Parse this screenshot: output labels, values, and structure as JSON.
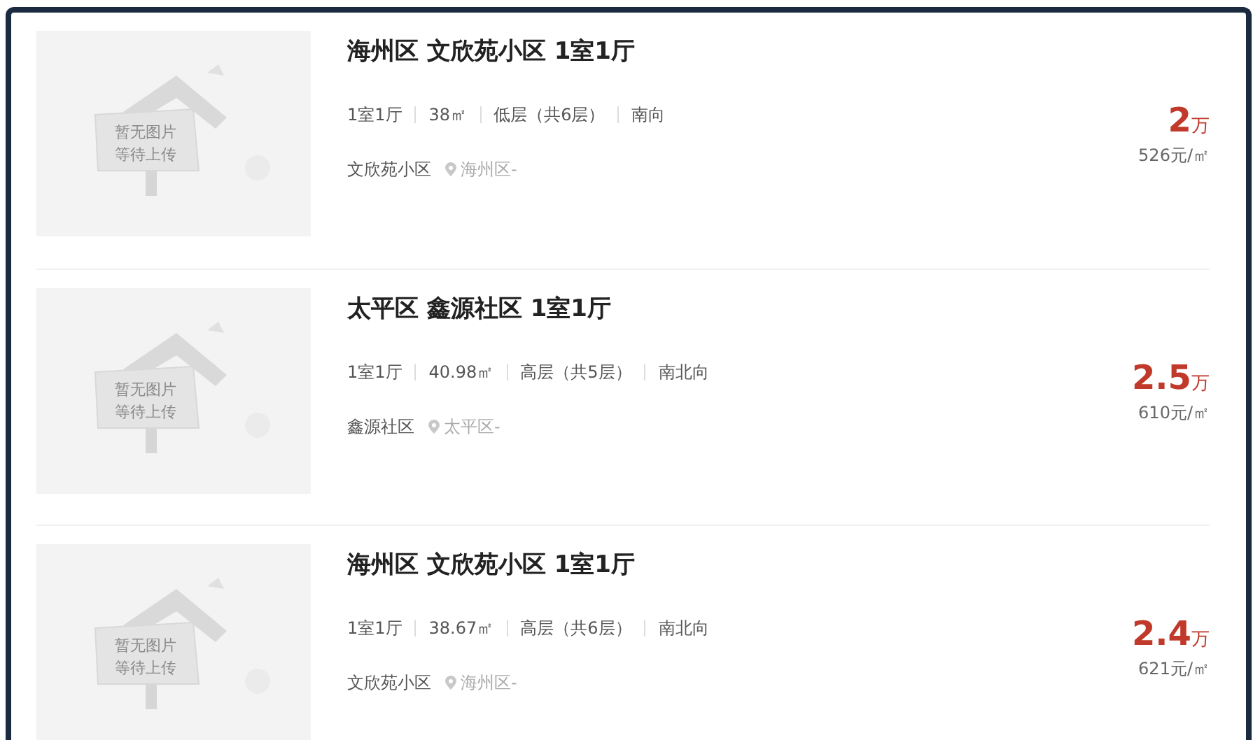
{
  "listings": [
    {
      "placeholder_text": [
        "暂无图片",
        "等待上传"
      ],
      "title": "海州区 文欣苑小区 1室1厅",
      "features": [
        "1室1厅",
        "38㎡",
        "低层（共6层）",
        "南向"
      ],
      "community": "文欣苑小区",
      "district": "海州区-",
      "price": "2",
      "price_unit": "万",
      "unit_price": "526元/㎡"
    },
    {
      "placeholder_text": [
        "暂无图片",
        "等待上传"
      ],
      "title": "太平区 鑫源社区 1室1厅",
      "features": [
        "1室1厅",
        "40.98㎡",
        "高层（共5层）",
        "南北向"
      ],
      "community": "鑫源社区",
      "district": "太平区-",
      "price": "2.5",
      "price_unit": "万",
      "unit_price": "610元/㎡"
    },
    {
      "placeholder_text": [
        "暂无图片",
        "等待上传"
      ],
      "title": "海州区 文欣苑小区 1室1厅",
      "features": [
        "1室1厅",
        "38.67㎡",
        "高层（共6层）",
        "南北向"
      ],
      "community": "文欣苑小区",
      "district": "海州区-",
      "price": "2.4",
      "price_unit": "万",
      "unit_price": "621元/㎡"
    }
  ]
}
